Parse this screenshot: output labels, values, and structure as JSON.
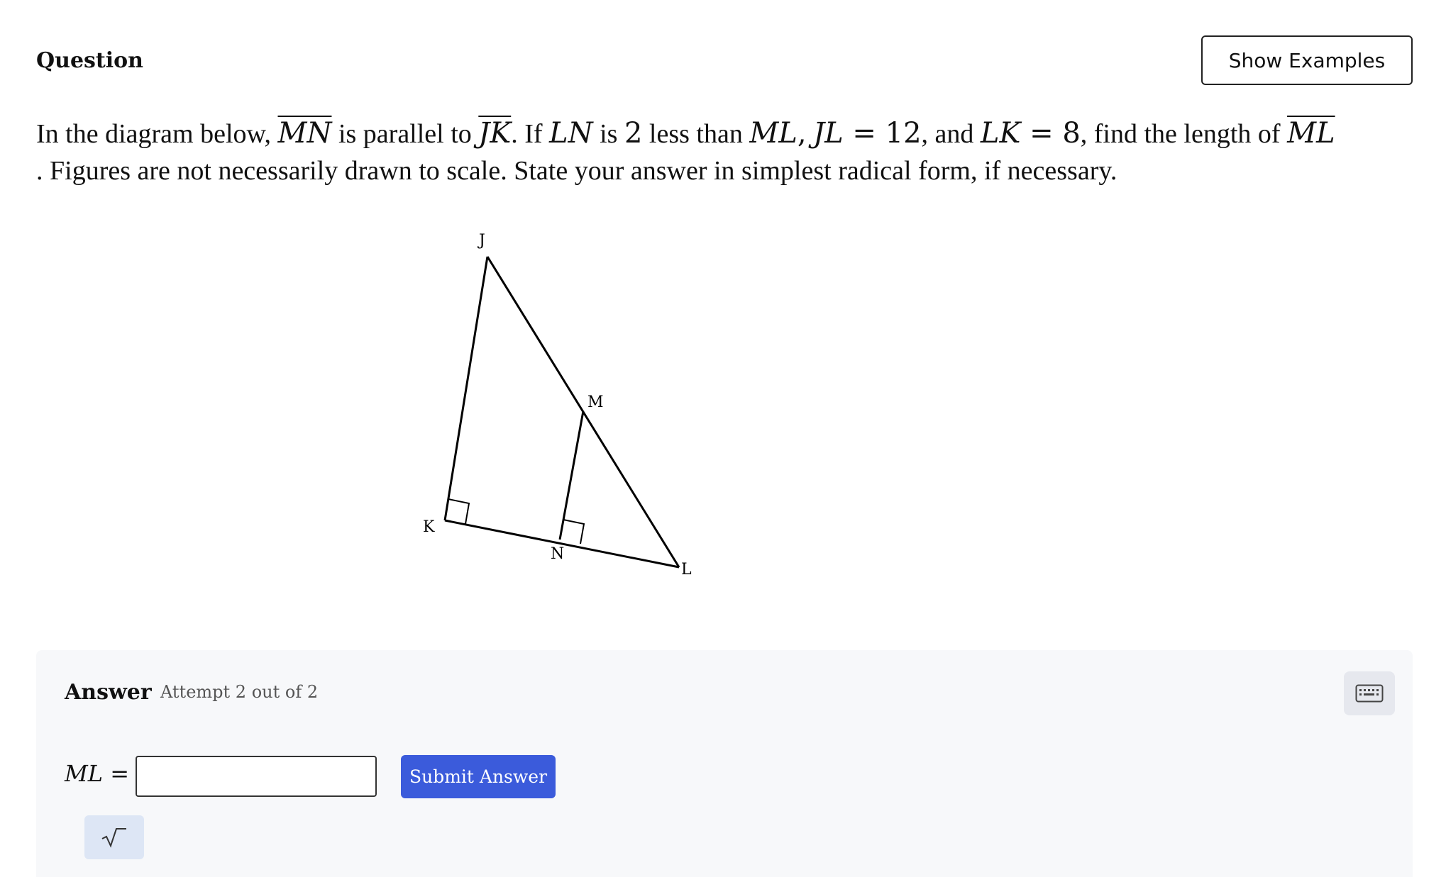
{
  "header": {
    "title": "Question",
    "show_examples_label": "Show Examples"
  },
  "prompt": {
    "t1": "In the diagram below, ",
    "seg_mn": "MN",
    "t2": " is parallel to ",
    "seg_jk": "JK",
    "t3": ". If ",
    "v_ln": "LN",
    "t4": " is ",
    "n2": "2",
    "t5": " less than ",
    "v_ml": "ML",
    "comma1": ",",
    "v_jl": "JL",
    "eq1": " = 12",
    "t6": ", and ",
    "v_lk": "LK",
    "eq2": " = 8",
    "t7": ", find the length of ",
    "seg_ml": "ML",
    "line2": ". Figures are not necessarily drawn to scale. State your answer in simplest radical form, if necessary."
  },
  "diagram": {
    "labels": {
      "J": "J",
      "M": "M",
      "K": "K",
      "N": "N",
      "L": "L"
    }
  },
  "answer": {
    "label": "Answer",
    "attempt_text": "Attempt 2 out of 2",
    "var_label": "ML",
    "equals": "=",
    "input_value": "",
    "submit_label": "Submit Answer",
    "keyboard_icon": "keyboard-icon",
    "sqrt_icon": "sqrt-icon"
  }
}
